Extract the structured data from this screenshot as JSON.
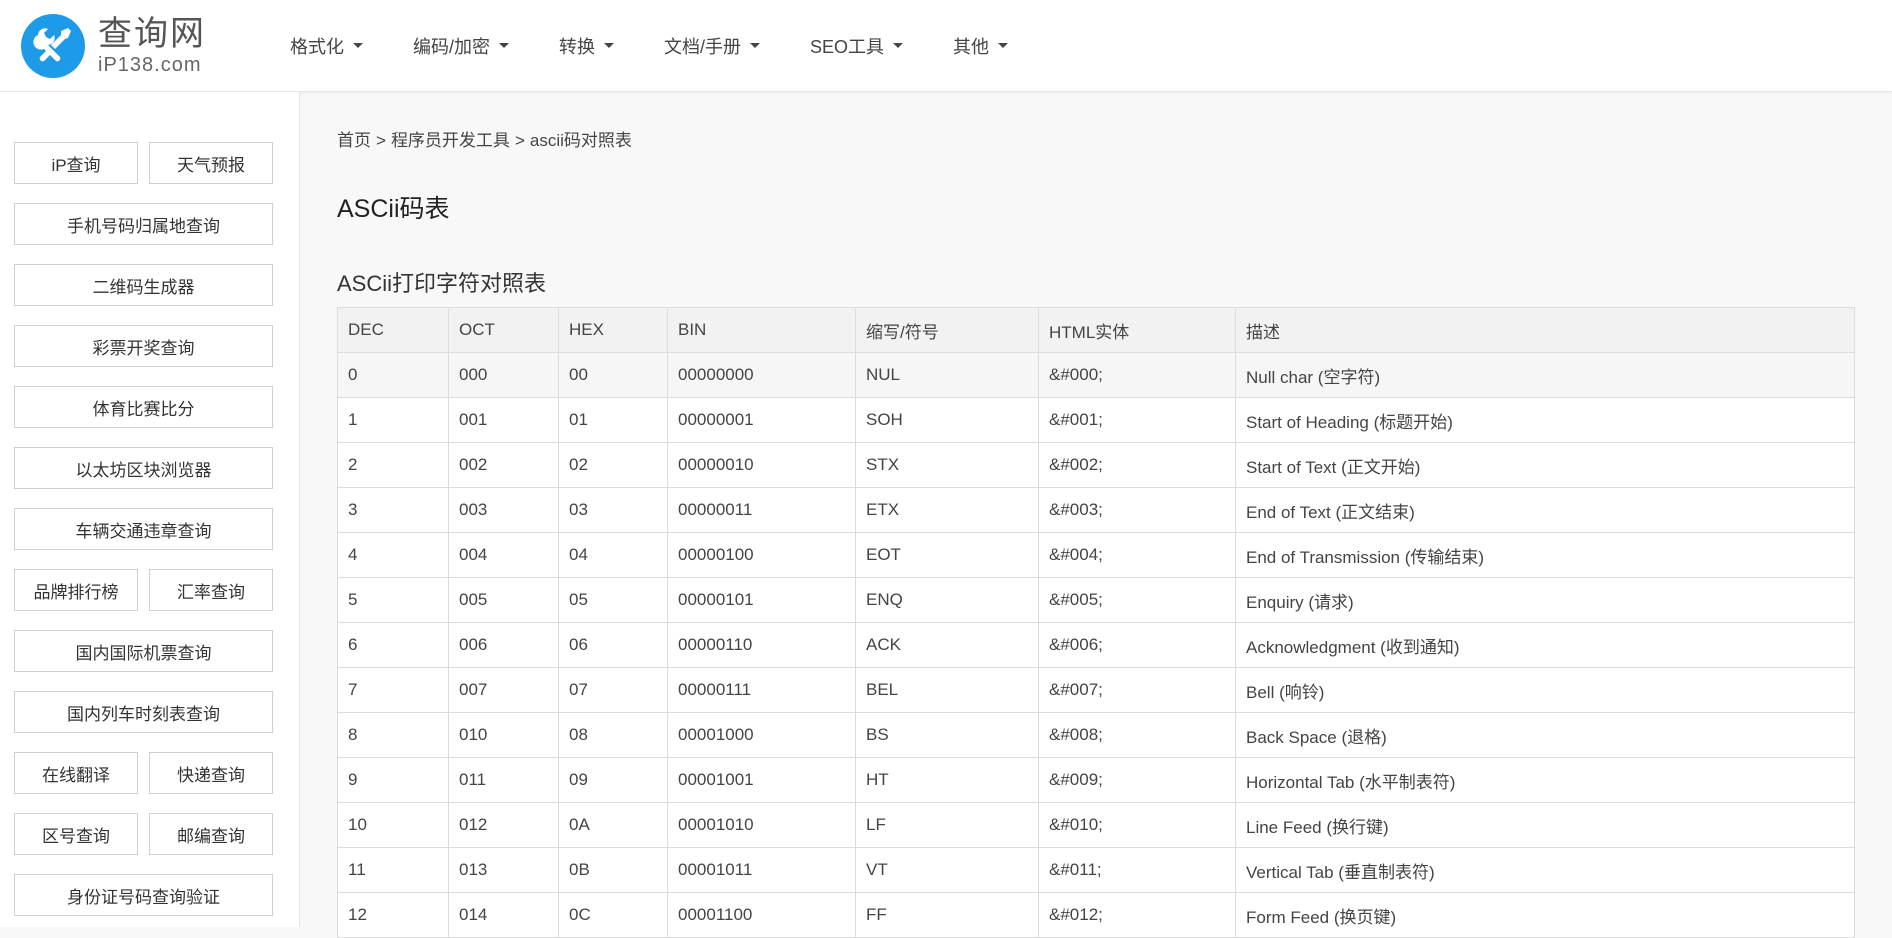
{
  "header": {
    "logo_title": "查询网",
    "logo_sub": "iP138.com",
    "nav": [
      {
        "label": "格式化"
      },
      {
        "label": "编码/加密"
      },
      {
        "label": "转换"
      },
      {
        "label": "文档/手册"
      },
      {
        "label": "SEO工具"
      },
      {
        "label": "其他"
      }
    ]
  },
  "sidebar": {
    "rows": [
      [
        "iP查询",
        "天气预报"
      ],
      [
        "手机号码归属地查询"
      ],
      [
        "二维码生成器"
      ],
      [
        "彩票开奖查询"
      ],
      [
        "体育比赛比分"
      ],
      [
        "以太坊区块浏览器"
      ],
      [
        "车辆交通违章查询"
      ],
      [
        "品牌排行榜",
        "汇率查询"
      ],
      [
        "国内国际机票查询"
      ],
      [
        "国内列车时刻表查询"
      ],
      [
        "在线翻译",
        "快递查询"
      ],
      [
        "区号查询",
        "邮编查询"
      ],
      [
        "身份证号码查询验证"
      ]
    ]
  },
  "breadcrumb": {
    "home": "首页",
    "parent": "程序员开发工具",
    "current": "ascii码对照表",
    "separator": ">"
  },
  "page_title": "ASCii码表",
  "section_title": "ASCii打印字符对照表",
  "table": {
    "headers": [
      "DEC",
      "OCT",
      "HEX",
      "BIN",
      "缩写/符号",
      "HTML实体",
      "描述"
    ],
    "rows": [
      [
        "0",
        "000",
        "00",
        "00000000",
        "NUL",
        "&#000;",
        "Null char (空字符)"
      ],
      [
        "1",
        "001",
        "01",
        "00000001",
        "SOH",
        "&#001;",
        "Start of Heading (标题开始)"
      ],
      [
        "2",
        "002",
        "02",
        "00000010",
        "STX",
        "&#002;",
        "Start of Text (正文开始)"
      ],
      [
        "3",
        "003",
        "03",
        "00000011",
        "ETX",
        "&#003;",
        "End of Text (正文结束)"
      ],
      [
        "4",
        "004",
        "04",
        "00000100",
        "EOT",
        "&#004;",
        "End of Transmission (传输结束)"
      ],
      [
        "5",
        "005",
        "05",
        "00000101",
        "ENQ",
        "&#005;",
        "Enquiry (请求)"
      ],
      [
        "6",
        "006",
        "06",
        "00000110",
        "ACK",
        "&#006;",
        "Acknowledgment (收到通知)"
      ],
      [
        "7",
        "007",
        "07",
        "00000111",
        "BEL",
        "&#007;",
        "Bell (响铃)"
      ],
      [
        "8",
        "010",
        "08",
        "00001000",
        "BS",
        "&#008;",
        "Back Space (退格)"
      ],
      [
        "9",
        "011",
        "09",
        "00001001",
        "HT",
        "&#009;",
        "Horizontal Tab (水平制表符)"
      ],
      [
        "10",
        "012",
        "0A",
        "00001010",
        "LF",
        "&#010;",
        "Line Feed (换行键)"
      ],
      [
        "11",
        "013",
        "0B",
        "00001011",
        "VT",
        "&#011;",
        "Vertical Tab (垂直制表符)"
      ],
      [
        "12",
        "014",
        "0C",
        "00001100",
        "FF",
        "&#012;",
        "Form Feed (换页键)"
      ]
    ]
  },
  "colors": {
    "logo_blue": "#1e9be8",
    "header_bg": "#ffffff",
    "page_bg": "#f8f8f8",
    "border": "#dcdcdc",
    "table_header_bg": "#f2f2f2"
  }
}
